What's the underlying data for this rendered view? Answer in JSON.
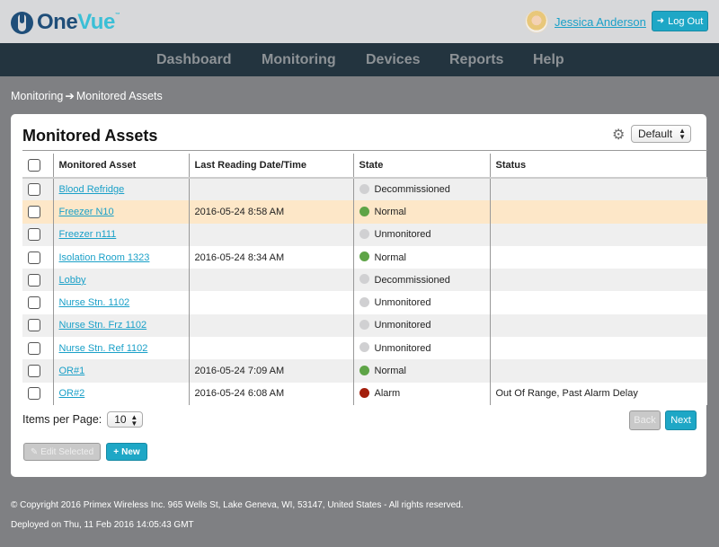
{
  "header": {
    "logo_part1": "One",
    "logo_part2": "Vue",
    "logo_tm": "™",
    "user_name": "Jessica Anderson",
    "logout_label": "Log Out",
    "logout_icon": "➜"
  },
  "nav": {
    "items": [
      {
        "label": "Dashboard"
      },
      {
        "label": "Monitoring"
      },
      {
        "label": "Devices"
      },
      {
        "label": "Reports"
      },
      {
        "label": "Help"
      }
    ]
  },
  "breadcrumb": {
    "parent": "Monitoring",
    "arrow": "➔",
    "current": "Monitored Assets"
  },
  "panel": {
    "title": "Monitored Assets",
    "gear_icon": "⚙",
    "view_selected": "Default"
  },
  "table": {
    "columns": [
      "Monitored Asset",
      "Last Reading Date/Time",
      "State",
      "Status"
    ],
    "rows": [
      {
        "asset": "Blood Refridge",
        "last_reading": "",
        "state": "Decommissioned",
        "state_color": "#d0d0d2",
        "status": ""
      },
      {
        "asset": "Freezer N10",
        "last_reading": "2016-05-24 8:58 AM",
        "state": "Normal",
        "state_color": "#5ea447",
        "status": ""
      },
      {
        "asset": "Freezer n111",
        "last_reading": "",
        "state": "Unmonitored",
        "state_color": "#d0d0d2",
        "status": ""
      },
      {
        "asset": "Isolation Room 1323",
        "last_reading": "2016-05-24 8:34 AM",
        "state": "Normal",
        "state_color": "#5ea447",
        "status": ""
      },
      {
        "asset": "Lobby",
        "last_reading": "",
        "state": "Decommissioned",
        "state_color": "#d0d0d2",
        "status": ""
      },
      {
        "asset": "Nurse Stn. 1102",
        "last_reading": "",
        "state": "Unmonitored",
        "state_color": "#d0d0d2",
        "status": ""
      },
      {
        "asset": "Nurse Stn. Frz 1102",
        "last_reading": "",
        "state": "Unmonitored",
        "state_color": "#d0d0d2",
        "status": ""
      },
      {
        "asset": "Nurse Stn. Ref 1102",
        "last_reading": "",
        "state": "Unmonitored",
        "state_color": "#d0d0d2",
        "status": ""
      },
      {
        "asset": "OR#1",
        "last_reading": "2016-05-24 7:09 AM",
        "state": "Normal",
        "state_color": "#5ea447",
        "status": ""
      },
      {
        "asset": "OR#2",
        "last_reading": "2016-05-24 6:08 AM",
        "state": "Alarm",
        "state_color": "#a31e0c",
        "status": "Out Of Range, Past Alarm Delay"
      }
    ]
  },
  "pagination": {
    "items_per_page_label": "Items per Page:",
    "items_per_page_value": "10",
    "back_label": "Back",
    "next_label": "Next"
  },
  "actions": {
    "edit_label": "Edit Selected",
    "edit_icon": "✎",
    "new_label": "New",
    "new_icon": "+"
  },
  "footer": {
    "copyright": "© Copyright 2016 Primex Wireless Inc. 965 Wells St, Lake Geneva, WI, 53147, United States - All rights reserved.",
    "deployed": "Deployed on Thu, 11 Feb 2016 14:05:43 GMT"
  }
}
